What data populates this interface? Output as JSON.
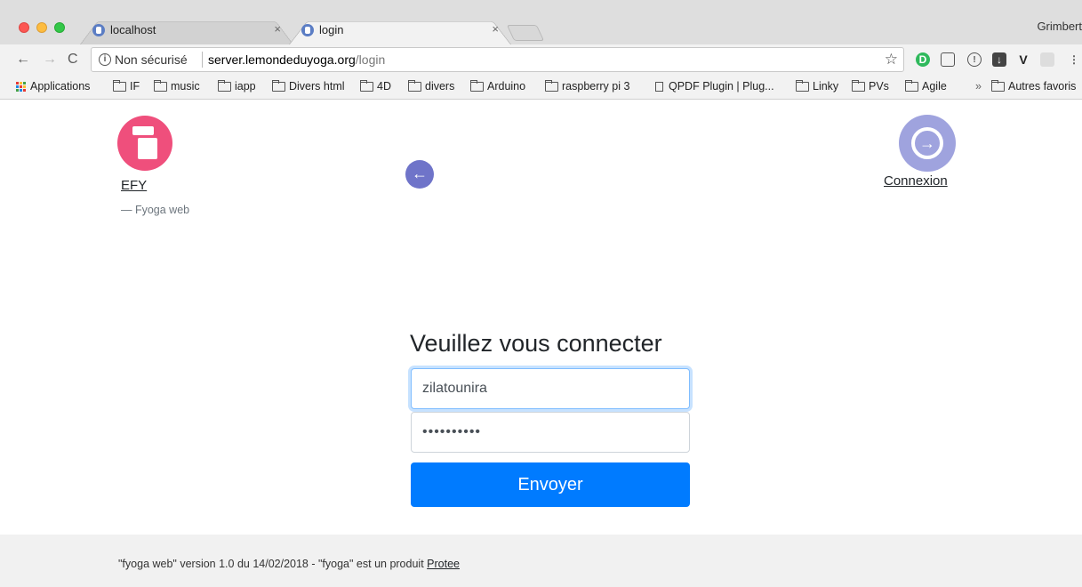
{
  "browser": {
    "tabs": [
      {
        "title": "localhost",
        "close": "×"
      },
      {
        "title": "login",
        "close": "×"
      }
    ],
    "profile_name": "Grimbert",
    "address": {
      "security_label": "Non sécurisé",
      "host": "server.lemondeduyoga.org",
      "path": "/login"
    },
    "bookmarks": {
      "apps": "Applications",
      "items": [
        "IF",
        "music",
        "iapp",
        "Divers html",
        "4D",
        "divers",
        "Arduino",
        "raspberry pi 3"
      ],
      "page_item": "QPDF Plugin | Plug...",
      "items2": [
        "Linky",
        "PVs",
        "Agile"
      ],
      "overflow": "»",
      "other": "Autres favoris"
    },
    "colors": {
      "tab_strip": "#dedede",
      "toolbar": "#f2f2f2"
    }
  },
  "page": {
    "left_logo": {
      "link": "EFY",
      "subtitle": "— Fyoga web",
      "color": "#ef4f7c",
      "icon": "efy-logo-icon"
    },
    "back": {
      "icon": "arrow-left-icon",
      "glyph": "←",
      "color": "#6f74c9"
    },
    "right_logo": {
      "link": "Connexion",
      "icon": "login-arrow-icon",
      "glyph": "→",
      "color": "#9fa3de"
    },
    "form": {
      "title": "Veuillez vous connecter",
      "username_value": "zilatounira",
      "password_value": "••••••••••",
      "submit_label": "Envoyer",
      "accent": "#007bff"
    },
    "footer": {
      "text": "\"fyoga web\" version 1.0 du 14/02/2018 - \"fyoga\" est un produit ",
      "link": "Protee"
    }
  }
}
